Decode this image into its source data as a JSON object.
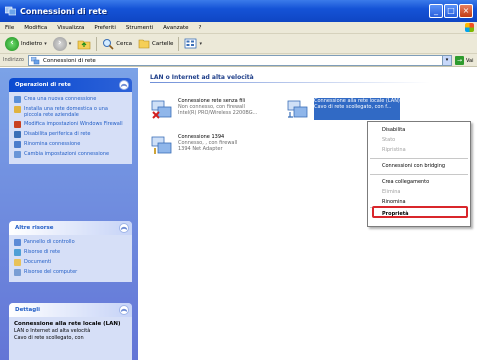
{
  "window": {
    "title": "Connessioni di rete"
  },
  "menu": [
    "File",
    "Modifica",
    "Visualizza",
    "Preferiti",
    "Strumenti",
    "Avanzate",
    "?"
  ],
  "toolbar": {
    "back_label": "Indietro",
    "search_label": "Cerca",
    "folders_label": "Cartelle"
  },
  "address": {
    "label": "Indirizzo",
    "value": "Connessioni di rete",
    "go_label": "Vai"
  },
  "sidebar": {
    "tasks_title": "Operazioni di rete",
    "tasks": [
      {
        "label": "Crea una nuova connessione",
        "icon": "new-connection-icon"
      },
      {
        "label": "Installa una rete domestica o una piccola rete aziendale",
        "icon": "home-network-icon"
      },
      {
        "label": "Modifica impostazioni Windows Firewall",
        "icon": "firewall-icon"
      },
      {
        "label": "Disabilita periferica di rete",
        "icon": "disable-device-icon"
      },
      {
        "label": "Rinomina connessione",
        "icon": "rename-icon"
      },
      {
        "label": "Cambia impostazioni connessione",
        "icon": "settings-icon"
      }
    ],
    "other_title": "Altre risorse",
    "other": [
      {
        "label": "Pannello di controllo",
        "icon": "control-panel-icon"
      },
      {
        "label": "Risorse di rete",
        "icon": "network-places-icon"
      },
      {
        "label": "Documenti",
        "icon": "documents-icon"
      },
      {
        "label": "Risorse del computer",
        "icon": "my-computer-icon"
      }
    ],
    "details_title": "Dettagli",
    "details": {
      "name": "Connessione alla rete locale (LAN)",
      "line1": "LAN o Internet ad alta velocità",
      "line2": "Cavo di rete scollegato, con"
    }
  },
  "main": {
    "group_title": "LAN o Internet ad alta velocità",
    "connections": [
      {
        "name": "Connessione rete senza fili",
        "status": "Non connesso, con firewall",
        "device": "Intel(R) PRO/Wireless 2200BG..."
      },
      {
        "name": "Connessione alla rete locale (LAN)",
        "status": "Cavo di rete scollegato, con f...",
        "device": ""
      },
      {
        "name": "Connessione 1394",
        "status": "Connesso, , con firewall",
        "device": "1394 Net Adapter"
      }
    ]
  },
  "context_menu": {
    "items": [
      "Disabilita",
      "Stato",
      "Ripristina",
      "Connessioni con bridging",
      "Crea collegamento",
      "Elimina",
      "Rinomina",
      "Proprietà"
    ],
    "disabled": [
      "Stato",
      "Ripristina",
      "Elimina"
    ],
    "highlighted": "Proprietà",
    "highlight_color": "#d9262b"
  }
}
